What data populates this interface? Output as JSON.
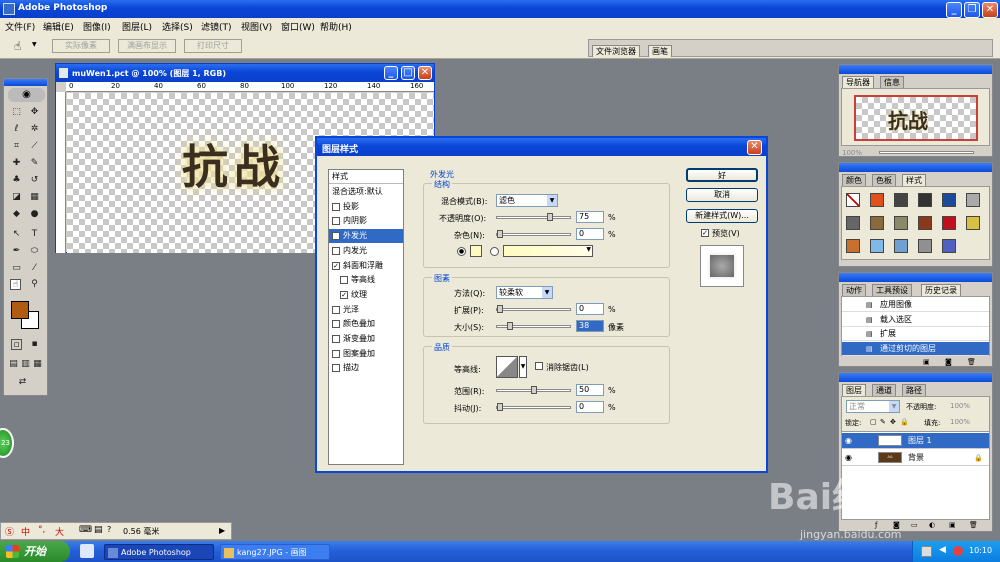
{
  "app": {
    "title": "Adobe Photoshop"
  },
  "menu": [
    "文件(F)",
    "编辑(E)",
    "图像(I)",
    "图层(L)",
    "选择(S)",
    "滤镜(T)",
    "视图(V)",
    "窗口(W)",
    "帮助(H)"
  ],
  "options_bar": {
    "buttons": [
      "实际像素",
      "满画布显示",
      "打印尺寸"
    ],
    "palette_tabs": [
      "文件浏览器",
      "画笔"
    ]
  },
  "document": {
    "title": "muWen1.pct @ 100% (图层 1, RGB)",
    "ruler_x": [
      "20",
      "40",
      "60",
      "80",
      "100",
      "120",
      "140",
      "160"
    ],
    "ruler_origin": "0",
    "artwork_text": "抗战"
  },
  "dialog": {
    "title": "图层样式",
    "styles_header": "样式",
    "styles": [
      {
        "label": "混合选项:默认",
        "checkbox": false,
        "checked": false,
        "indent": false,
        "active": false
      },
      {
        "label": "投影",
        "checkbox": true,
        "checked": false,
        "indent": false,
        "active": false
      },
      {
        "label": "内阴影",
        "checkbox": true,
        "checked": false,
        "indent": false,
        "active": false
      },
      {
        "label": "外发光",
        "checkbox": true,
        "checked": true,
        "indent": false,
        "active": true
      },
      {
        "label": "内发光",
        "checkbox": true,
        "checked": false,
        "indent": false,
        "active": false
      },
      {
        "label": "斜面和浮雕",
        "checkbox": true,
        "checked": true,
        "indent": false,
        "active": false
      },
      {
        "label": "等高线",
        "checkbox": true,
        "checked": false,
        "indent": true,
        "active": false
      },
      {
        "label": "纹理",
        "checkbox": true,
        "checked": true,
        "indent": true,
        "active": false
      },
      {
        "label": "光泽",
        "checkbox": true,
        "checked": false,
        "indent": false,
        "active": false
      },
      {
        "label": "颜色叠加",
        "checkbox": true,
        "checked": false,
        "indent": false,
        "active": false
      },
      {
        "label": "渐变叠加",
        "checkbox": true,
        "checked": false,
        "indent": false,
        "active": false
      },
      {
        "label": "图案叠加",
        "checkbox": true,
        "checked": false,
        "indent": false,
        "active": false
      },
      {
        "label": "描边",
        "checkbox": true,
        "checked": false,
        "indent": false,
        "active": false
      }
    ],
    "outer_glow": {
      "title": "外发光",
      "structure": {
        "title": "结构",
        "blend_mode_label": "混合模式(B):",
        "blend_mode_value": "滤色",
        "opacity_label": "不透明度(O):",
        "opacity_value": "75",
        "opacity_level": 0.75,
        "noise_label": "杂色(N):",
        "noise_value": "0",
        "noise_level": 0,
        "unit": "%"
      },
      "elements": {
        "title": "图素",
        "method_label": "方法(Q):",
        "method_value": "较柔软",
        "spread_label": "扩展(P):",
        "spread_value": "0",
        "spread_level": 0,
        "size_label": "大小(S):",
        "size_value": "38",
        "size_level": 0.15,
        "unit_pct": "%",
        "unit_px": "像素"
      },
      "quality": {
        "title": "品质",
        "contour_label": "等高线:",
        "antialias_label": "消除锯齿(L)",
        "range_label": "范围(R):",
        "range_value": "50",
        "range_level": 0.5,
        "jitter_label": "抖动(J):",
        "jitter_value": "0",
        "jitter_level": 0,
        "unit": "%"
      }
    },
    "buttons": {
      "ok": "好",
      "cancel": "取消",
      "new_style": "新建样式(W)...",
      "preview": "预览(V)"
    }
  },
  "navigator": {
    "tabs": [
      "导航器",
      "信息"
    ],
    "preview_text": "抗战",
    "zoom": "100%"
  },
  "swatches": {
    "tabs": [
      "颜色",
      "色板",
      "样式"
    ]
  },
  "history": {
    "tabs": [
      "动作",
      "工具预设",
      "历史记录"
    ],
    "items": [
      {
        "label": "应用图像",
        "active": false
      },
      {
        "label": "载入选区",
        "active": false
      },
      {
        "label": "扩展",
        "active": false
      },
      {
        "label": "通过剪切的图层",
        "active": true
      }
    ]
  },
  "layers": {
    "tabs": [
      "图层",
      "通道",
      "路径"
    ],
    "blend_mode": "正常",
    "opacity_label": "不透明度:",
    "opacity_value": "100%",
    "lock_label": "锁定:",
    "fill_label": "填充:",
    "fill_value": "100%",
    "items": [
      {
        "label": "图层 1",
        "active": true,
        "thumb": ""
      },
      {
        "label": "背景",
        "active": false,
        "thumb": "ᴬᴬ"
      }
    ]
  },
  "status_bar": {
    "ime": "中",
    "ime2": "大",
    "size_text": "0.56 毫米"
  },
  "taskbar": {
    "start": "开始",
    "tasks": [
      "Adobe Photoshop",
      "kang27.JPG - 画图"
    ],
    "clock": "10:10"
  },
  "watermark": {
    "text": "Bai经验",
    "url": "jingyan.baidu.com"
  },
  "badge": "23",
  "colors": {
    "accent": "#0a46d8",
    "foreground": "#b05a12",
    "selection": "#316ac5"
  }
}
